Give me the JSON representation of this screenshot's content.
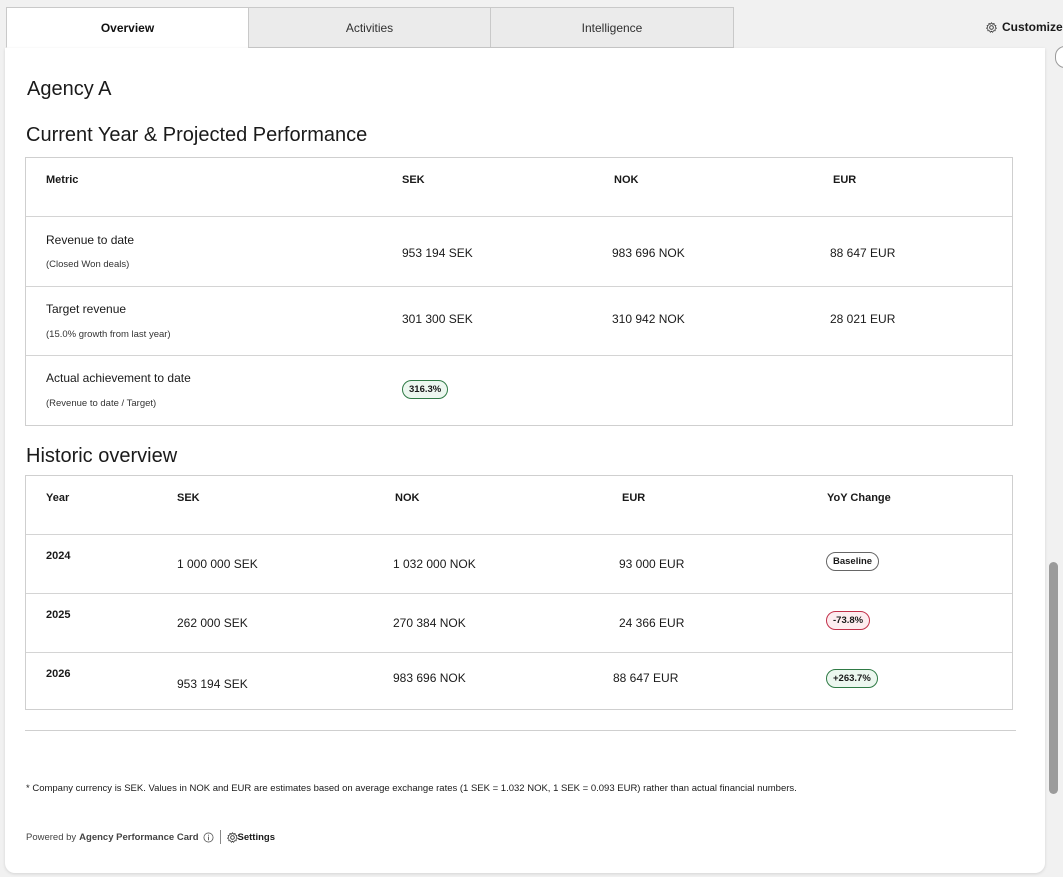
{
  "tabs": [
    {
      "label": "Overview",
      "active": true
    },
    {
      "label": "Activities",
      "active": false
    },
    {
      "label": "Intelligence",
      "active": false
    }
  ],
  "customize_label": "Customize",
  "agency_name": "Agency A",
  "current": {
    "title": "Current Year & Projected Performance",
    "headers": [
      "Metric",
      "SEK",
      "NOK",
      "EUR"
    ],
    "rows": [
      {
        "label": "Revenue to date",
        "sub": "(Closed Won deals)",
        "sek": "953 194 SEK",
        "nok": "983 696 NOK",
        "eur": "88 647 EUR"
      },
      {
        "label": "Target revenue",
        "sub": "(15.0% growth from last year)",
        "sek": "301 300 SEK",
        "nok": "310 942 NOK",
        "eur": "28 021 EUR"
      },
      {
        "label": "Actual achievement to date",
        "sub": "(Revenue to date / Target)",
        "badge": "316.3%"
      }
    ]
  },
  "historic": {
    "title": "Historic overview",
    "headers": [
      "Year",
      "SEK",
      "NOK",
      "EUR",
      "YoY Change"
    ],
    "rows": [
      {
        "year": "2024",
        "sek": "1 000 000 SEK",
        "nok": "1 032 000 NOK",
        "eur": "93 000 EUR",
        "change": "Baseline",
        "status": "neutral"
      },
      {
        "year": "2025",
        "sek": "262 000 SEK",
        "nok": "270 384 NOK",
        "eur": "24 366 EUR",
        "change": "-73.8%",
        "status": "negative"
      },
      {
        "year": "2026",
        "sek": "953 194 SEK",
        "nok": "983 696 NOK",
        "eur": "88 647 EUR",
        "change": "+263.7%",
        "status": "positive"
      }
    ]
  },
  "footnote": "* Company currency is SEK. Values in NOK and EUR are estimates based on average exchange rates (1 SEK = 1.032 NOK, 1 SEK = 0.093 EUR) rather than actual financial numbers.",
  "footer": {
    "powered_by": "Powered by",
    "brand": "Agency Performance Card",
    "settings_label": "Settings"
  },
  "colors": {
    "positive": "#2f7a45",
    "negative": "#c2304a",
    "neutral": "#666666"
  }
}
